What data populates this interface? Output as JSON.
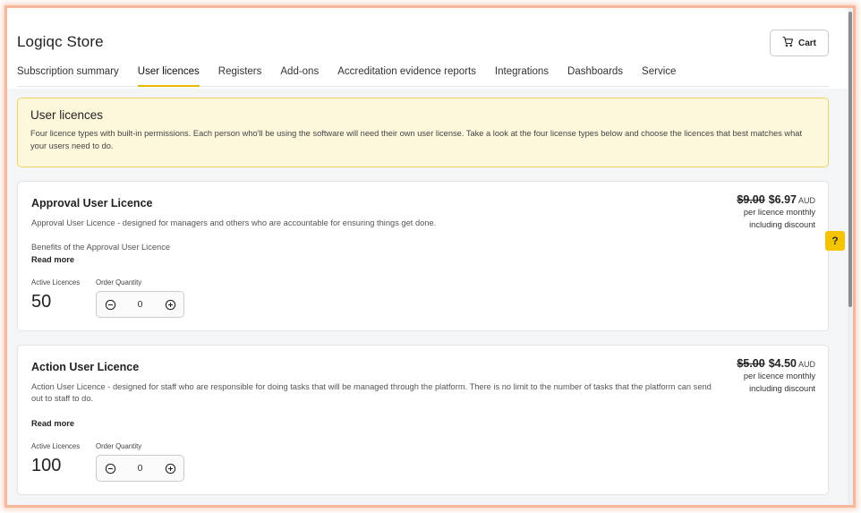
{
  "header": {
    "title": "Logiqc Store",
    "cart_label": "Cart"
  },
  "tabs": [
    {
      "label": "Subscription summary",
      "active": false
    },
    {
      "label": "User licences",
      "active": true
    },
    {
      "label": "Registers",
      "active": false
    },
    {
      "label": "Add-ons",
      "active": false
    },
    {
      "label": "Accreditation evidence reports",
      "active": false
    },
    {
      "label": "Integrations",
      "active": false
    },
    {
      "label": "Dashboards",
      "active": false
    },
    {
      "label": "Service",
      "active": false
    }
  ],
  "info": {
    "title": "User licences",
    "text": "Four licence types with built-in permissions. Each person who'll be using the software will need their own user license. Take a look at the four license types below and choose the licences that best matches what your users need to do."
  },
  "labels": {
    "active_licences": "Active Licences",
    "order_quantity": "Order Quantity",
    "read_more": "Read more",
    "price_note_1": "per licence monthly",
    "price_note_2": "including discount",
    "help": "?"
  },
  "licences": [
    {
      "title": "Approval User Licence",
      "description": "Approval User Licence - designed for managers and others who are accountable for ensuring things get done.",
      "benefits": "Benefits of the Approval User Licence",
      "active": "50",
      "quantity": "0",
      "old_price": "$9.00",
      "new_price": "$6.97",
      "currency": "AUD"
    },
    {
      "title": "Action User Licence",
      "description": "Action User Licence - designed for staff who are responsible for doing tasks that will be managed through the platform. There is no limit to the number of tasks that the platform can send out to staff to do.",
      "benefits": "",
      "active": "100",
      "quantity": "0",
      "old_price": "$5.00",
      "new_price": "$4.50",
      "currency": "AUD"
    }
  ],
  "colors": {
    "accent": "#e6b800",
    "info_bg": "#fdf8dc",
    "help_bg": "#f5c400"
  }
}
